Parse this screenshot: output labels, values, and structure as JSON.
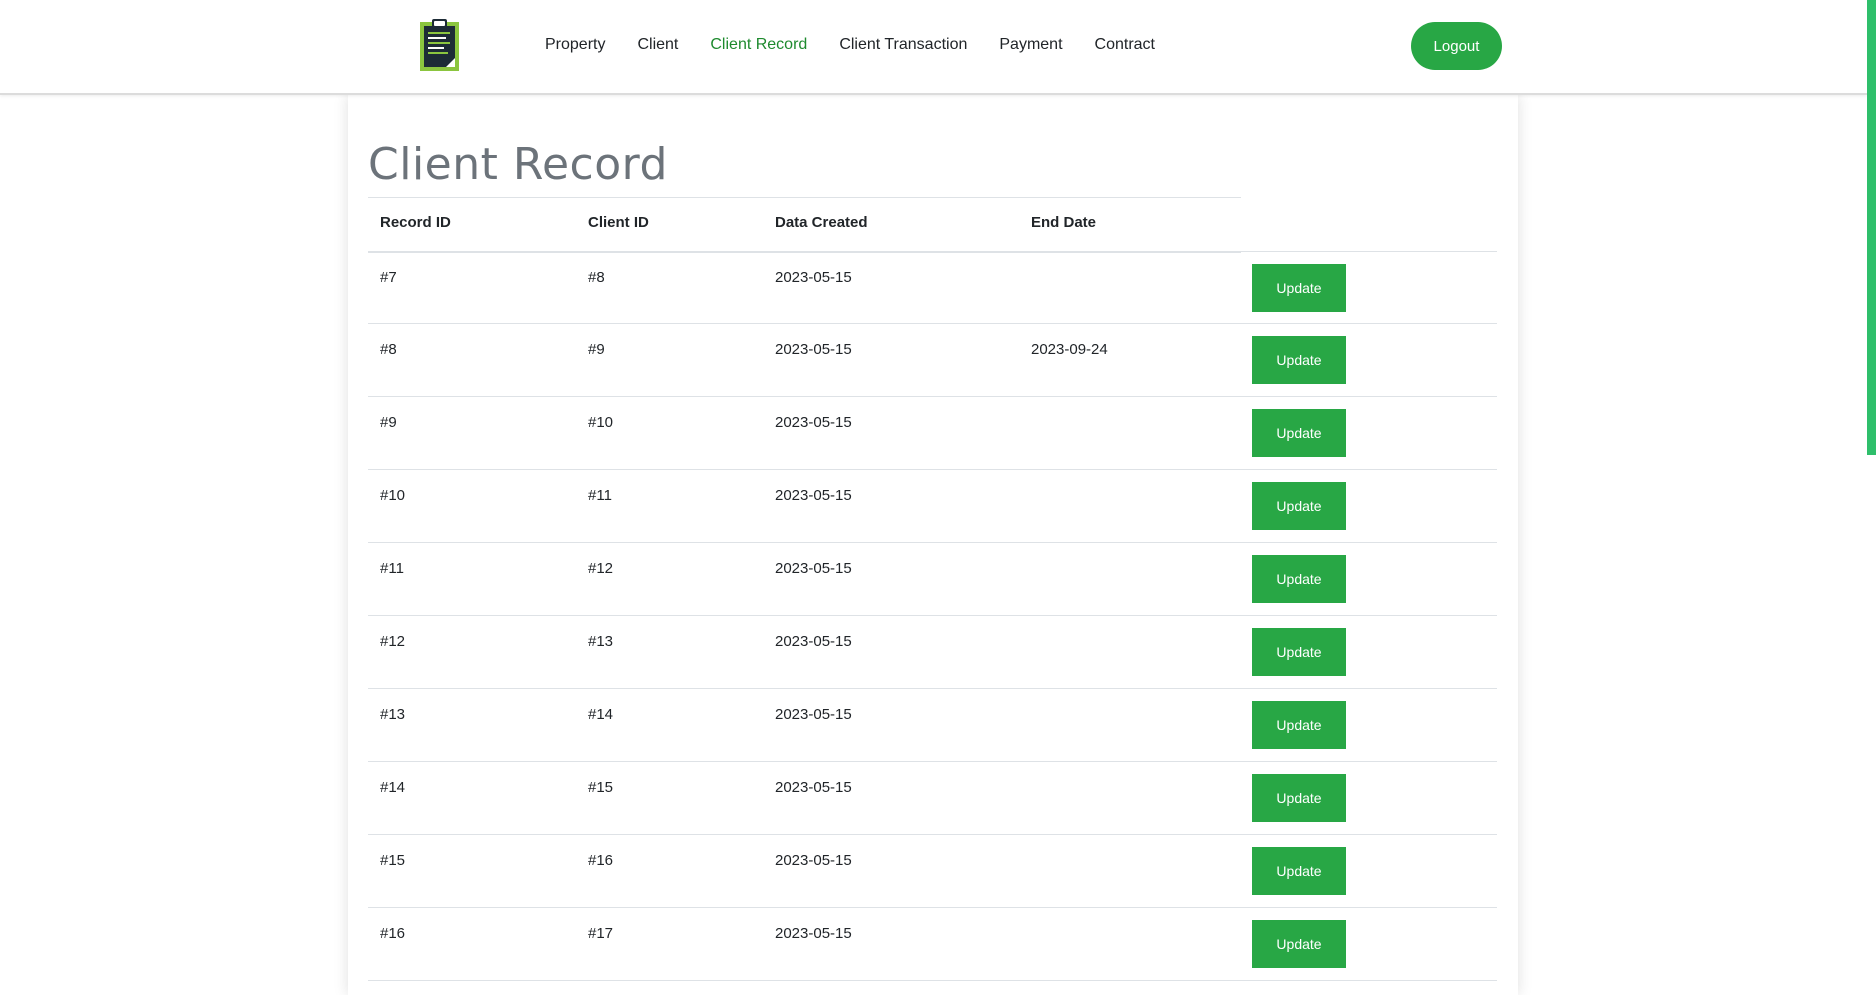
{
  "nav": {
    "logo_icon": "clipboard-icon",
    "links": [
      {
        "label": "Property",
        "active": false
      },
      {
        "label": "Client",
        "active": false
      },
      {
        "label": "Client Record",
        "active": true
      },
      {
        "label": "Client Transaction",
        "active": false
      },
      {
        "label": "Payment",
        "active": false
      },
      {
        "label": "Contract",
        "active": false
      }
    ],
    "logout_label": "Logout"
  },
  "page": {
    "title": "Client Record"
  },
  "table": {
    "headers": [
      "Record ID",
      "Client ID",
      "Data Created",
      "End Date"
    ],
    "action_label": "Update",
    "rows": [
      {
        "record_id": "#7",
        "client_id": "#8",
        "created": "2023-05-15",
        "end": ""
      },
      {
        "record_id": "#8",
        "client_id": "#9",
        "created": "2023-05-15",
        "end": "2023-09-24"
      },
      {
        "record_id": "#9",
        "client_id": "#10",
        "created": "2023-05-15",
        "end": ""
      },
      {
        "record_id": "#10",
        "client_id": "#11",
        "created": "2023-05-15",
        "end": ""
      },
      {
        "record_id": "#11",
        "client_id": "#12",
        "created": "2023-05-15",
        "end": ""
      },
      {
        "record_id": "#12",
        "client_id": "#13",
        "created": "2023-05-15",
        "end": ""
      },
      {
        "record_id": "#13",
        "client_id": "#14",
        "created": "2023-05-15",
        "end": ""
      },
      {
        "record_id": "#14",
        "client_id": "#15",
        "created": "2023-05-15",
        "end": ""
      },
      {
        "record_id": "#15",
        "client_id": "#16",
        "created": "2023-05-15",
        "end": ""
      },
      {
        "record_id": "#16",
        "client_id": "#17",
        "created": "2023-05-15",
        "end": ""
      }
    ]
  },
  "colors": {
    "accent": "#28a745",
    "active_link": "#1e8a2e",
    "title": "#6c737a",
    "scroll_thumb": "#2fbf6b"
  }
}
